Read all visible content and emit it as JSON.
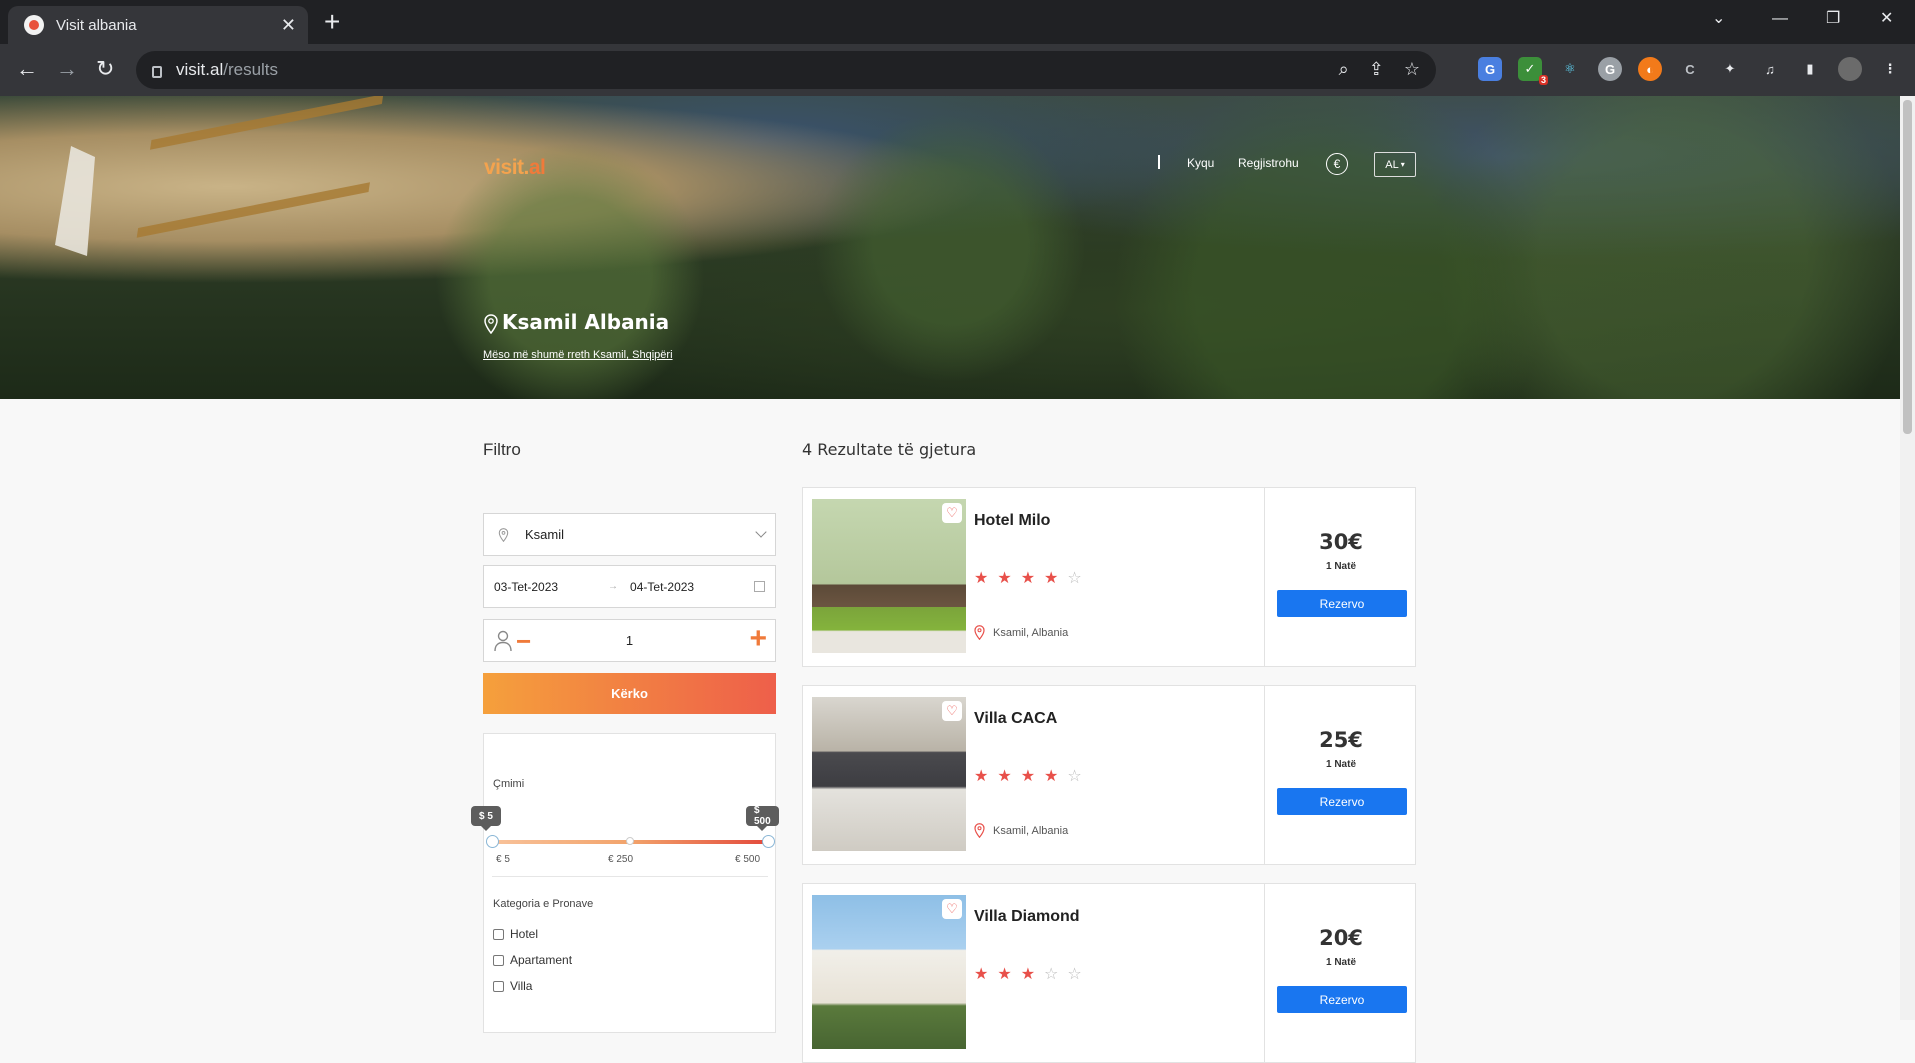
{
  "browser": {
    "tab_title": "Visit albania",
    "url_host": "visit.al",
    "url_path": "/results",
    "extension_badge": "3"
  },
  "header": {
    "logo_main": "visit.",
    "logo_accent": "al",
    "login": "Kyqu",
    "register": "Regjistrohu",
    "currency_symbol": "€",
    "language": "AL"
  },
  "hero": {
    "place": "Ksamil Albania",
    "learn_more": "Mëso më shumë rreth Ksamil, Shqipëri"
  },
  "filter": {
    "title": "Filtro",
    "location": "Ksamil",
    "check_in": "03-Tet-2023",
    "check_out": "04-Tet-2023",
    "guests": "1",
    "search_label": "Kërko",
    "price_title": "Çmimi",
    "price_min_bubble": "$ 5",
    "price_max_bubble": "$ 500",
    "price_selected_min": 5,
    "price_selected_max": 500,
    "ticks": [
      "€ 5",
      "€ 250",
      "€ 500"
    ],
    "category_title": "Kategoria e Pronave",
    "categories": [
      "Hotel",
      "Apartament",
      "Villa"
    ]
  },
  "results": {
    "title": "4 Rezultate të gjetura",
    "items": [
      {
        "name": "Hotel Milo",
        "stars": 4,
        "location": "Ksamil, Albania",
        "price": "30€",
        "per": "1 Natë",
        "book": "Rezervo"
      },
      {
        "name": "Villa CACA",
        "stars": 4,
        "location": "Ksamil, Albania",
        "price": "25€",
        "per": "1 Natë",
        "book": "Rezervo"
      },
      {
        "name": "Villa Diamond",
        "stars": 3,
        "location": "Ksamil, Albania",
        "price": "20€",
        "per": "1 Natë",
        "book": "Rezervo"
      }
    ]
  },
  "colors": {
    "brand_orange": "#f07a3a",
    "star_red": "#e8504a",
    "button_blue": "#1976f0"
  }
}
